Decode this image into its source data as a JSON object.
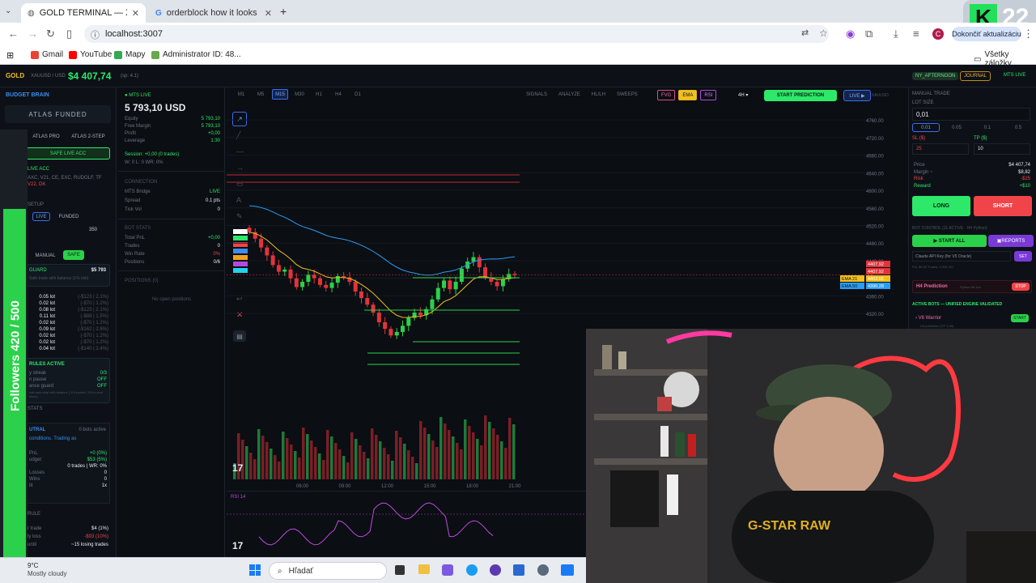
{
  "browser": {
    "tabs": [
      {
        "label": "GOLD TERMINAL — XAUUSD"
      },
      {
        "label": "orderblock how it looks - Hľad..."
      }
    ],
    "url": "localhost:3007",
    "update_label": "Dokončiť aktualizáciu",
    "avatar_letter": "C",
    "bookmarks": [
      {
        "label": "Gmail",
        "color": "#ea4335"
      },
      {
        "label": "YouTube",
        "color": "#ff0000"
      },
      {
        "label": "Mapy",
        "color": "#34a853"
      },
      {
        "label": "Administrator ID: 48...",
        "color": "#6aa84f"
      }
    ],
    "all_bookmarks": "Všetky záložky",
    "overlay_number": "22"
  },
  "header": {
    "symbol": "GOLD",
    "pair": "XAUUSD / USD",
    "price": "$4 407,74",
    "sp": "(sp: 4.1)",
    "timeframes": [
      "M1",
      "M5",
      "M15",
      "M30",
      "H1",
      "H4",
      "D1"
    ],
    "active_timeframe": "M15",
    "tools": [
      "SIGNALS",
      "ANALYZE",
      "HL/LH",
      "SWEEPS"
    ],
    "toggles": [
      "FVG",
      "EMA",
      "RSI"
    ],
    "interval": "4H",
    "start_prediction": "START PREDICTION",
    "live_label": "LIVE ▶",
    "symbol_right": "XAUUSD",
    "session_badge": "NY_AFTERNOON",
    "journal": "JOURNAL",
    "mts_live": "MTS LIVE"
  },
  "left": {
    "brand": "BUDGET BRAIN",
    "funded": "ATLAS FUNDED",
    "tabs": [
      "ATLAS PRO",
      "ATLAS 2-STEP"
    ],
    "safe_live": "SAFE LIVE ACC",
    "live_acc": "LIVE ACC",
    "acc_list": "AXC, V21, CE, EXC, RUDOLF, TF",
    "acc_list2": "V22, DK",
    "setup": "SETUP",
    "mode_live": "LIVE",
    "mode_funded": "FUNDED",
    "amount": "350",
    "manual": "MANUAL",
    "safe": "SAFE",
    "guard_label": "GUARD",
    "guard_amount": "$5 793",
    "guard_sub": "Safe trade with balance (1% risk)",
    "lots": [
      {
        "lot": "0.05 lot",
        "val": "(-$123 | 2.1%)"
      },
      {
        "lot": "0.02 lot",
        "val": "(-$70 | 1.2%)"
      },
      {
        "lot": "0.08 lot",
        "val": "(-$123 | 2.1%)"
      },
      {
        "lot": "0.11 lot",
        "val": "(-$89 | 1.5%)"
      },
      {
        "lot": "0.02 lot",
        "val": "(-$70 | 1.2%)"
      },
      {
        "lot": "0.09 lot",
        "val": "(-$162 | 2.8%)"
      },
      {
        "lot": "0.02 lot",
        "val": "(-$70 | 1.2%)"
      },
      {
        "lot": "0.02 lot",
        "val": "(-$70 | 1.2%)"
      },
      {
        "lot": "0.04 lot",
        "val": "(-$140 | 2.4%)"
      }
    ],
    "rules_title": "RULES ACTIVE",
    "rules": [
      {
        "label": "y streak",
        "val": "0/3"
      },
      {
        "label": "n pause",
        "val": "OFF"
      },
      {
        "label": "ance guard",
        "val": "OFF"
      }
    ],
    "rules_note": "soft auto-stop with balance (-1% pause | 3% in-soul block)",
    "stats_label": "STATS",
    "neutral": "UTRAL",
    "bots_active": "0 bots active",
    "conditions": "conditions. Trading as",
    "pnl_label": "PnL",
    "pnl_val": "+0 (0%)",
    "budget_label": "udget",
    "budget_val": "$53 (5%)",
    "trades_line": "0 trades | WR: 0%",
    "losses_label": "Losses",
    "losses_val": "0",
    "wins_label": "Wins",
    "wins_val": "0",
    "tilt_label": "ilt",
    "tilt_val": "1x",
    "rule2_label": "RULE",
    "per_trade_label": "r trade",
    "per_trade_val": "$4 (1%)",
    "daily_loss_label": "ly loss",
    "daily_loss_val": "-$93 (10%)",
    "until_label": "until",
    "until_val": "~15 losing trades",
    "weather_temp": "9°C",
    "weather_desc": "Mostly cloudy"
  },
  "account": {
    "status": "MTS LIVE",
    "balance": "5 793,10 USD",
    "rows": [
      {
        "label": "Equity",
        "val": "5 793,10"
      },
      {
        "label": "Free Margin",
        "val": "5 793,10"
      },
      {
        "label": "Profit",
        "val": "+0,00"
      },
      {
        "label": "Leverage",
        "val": "1:30"
      }
    ],
    "session": "Session: +0,00 (0 trades)",
    "wl": "W: 0  L: 0  WR: 0%",
    "connection_title": "CONNECTION",
    "connection": [
      {
        "label": "MTS Bridge",
        "val": "LIVE"
      },
      {
        "label": "Spread",
        "val": "0.1 pts"
      },
      {
        "label": "Tick Vol",
        "val": "0"
      }
    ],
    "bot_stats_title": "BOT STATS",
    "bot_stats": [
      {
        "label": "Total PnL",
        "val": "+0,00"
      },
      {
        "label": "Trades",
        "val": "0"
      },
      {
        "label": "Win Rate",
        "val": "0%"
      },
      {
        "label": "Positions",
        "val": "0/6"
      }
    ],
    "positions_title": "POSITIONS (0)",
    "no_positions": "No open positions"
  },
  "chart_data": {
    "type": "candlestick",
    "symbol": "XAUUSD",
    "timeframe": "M15",
    "y_ticks": [
      4760,
      4720,
      4680,
      4640,
      4600,
      4560,
      4520,
      4480,
      4440,
      4400,
      4360,
      4320
    ],
    "y_tick_labels": [
      "4760.00",
      "4720.00",
      "4680.00",
      "4640.00",
      "4600.00",
      "4560.00",
      "4520.00",
      "4480.00",
      "4440.00",
      "4400.00",
      "4360.00",
      "4320.00"
    ],
    "ylim": [
      4300,
      4775
    ],
    "x_ticks": [
      "06:00",
      "09:00",
      "12:00",
      "15:00",
      "18:00",
      "21:00"
    ],
    "price_labels": [
      {
        "label": "",
        "value": "4407.92",
        "color": "#e0343a"
      },
      {
        "label": "",
        "value": "4407.92",
        "color": "#e0343a"
      },
      {
        "label": "EMA 21",
        "value": "4403.65",
        "color": "#f0c020"
      },
      {
        "label": "EMA 50",
        "value": "4390.28",
        "color": "#2a9df4"
      }
    ],
    "close_series": [
      4505,
      4490,
      4470,
      4452,
      4430,
      4415,
      4420,
      4400,
      4380,
      4392,
      4408,
      4400,
      4385,
      4378,
      4390,
      4405,
      4402,
      4392,
      4370,
      4355,
      4340,
      4322,
      4300,
      4285,
      4270,
      4278,
      4292,
      4310,
      4322,
      4316,
      4330,
      4352,
      4378,
      4395,
      4375,
      4392,
      4422,
      4438,
      4448,
      4425,
      4402,
      4392,
      4382,
      4398,
      4410,
      4407
    ],
    "rsi_label": "RSI 14"
  },
  "right": {
    "manual_trade": "MANUAL TRADE",
    "lot_size": "LOT SIZE",
    "lot_value": "0,01",
    "lot_options": [
      "0.01",
      "0.05",
      "0.1",
      "0.5"
    ],
    "sl_label": "SL ($)",
    "tp_label": "TP ($)",
    "sl_value": "25",
    "tp_value": "10",
    "info": [
      {
        "label": "Price",
        "val": "$4 407,74"
      },
      {
        "label": "Margin ~",
        "val": "$8,82"
      },
      {
        "label": "Risk",
        "val": "-$25"
      },
      {
        "label": "Reward",
        "val": "+$10"
      }
    ],
    "long": "LONG",
    "short": "SHORT",
    "bot_control": "BOT CONTROL (11 ACTIVE · H4 Python)",
    "start_all": "▶ START ALL",
    "reports": "REPORTS",
    "api_key": "Claude API Key (for V5 Oracle)",
    "set": "SET",
    "pnl_line": "PnL $0.00  Trades: 0  W/L 0/0",
    "h4_prediction": "H4 Prediction",
    "h4_sub": "Python ML bot",
    "stop": "STOP",
    "active_bots": "ACTIVE BOTS — UNIFIED ENGINE VALIDATED",
    "v6_warrior": "V6 Warrior",
    "v6_sub": "H4 prediction (TP 1.50)",
    "start": "START"
  },
  "stream": {
    "followers": "Followers 420 / 500",
    "followers_fraction": 0.84,
    "shirt_text": "G-STAR RAW"
  },
  "taskbar": {
    "search": "Hľadať"
  }
}
